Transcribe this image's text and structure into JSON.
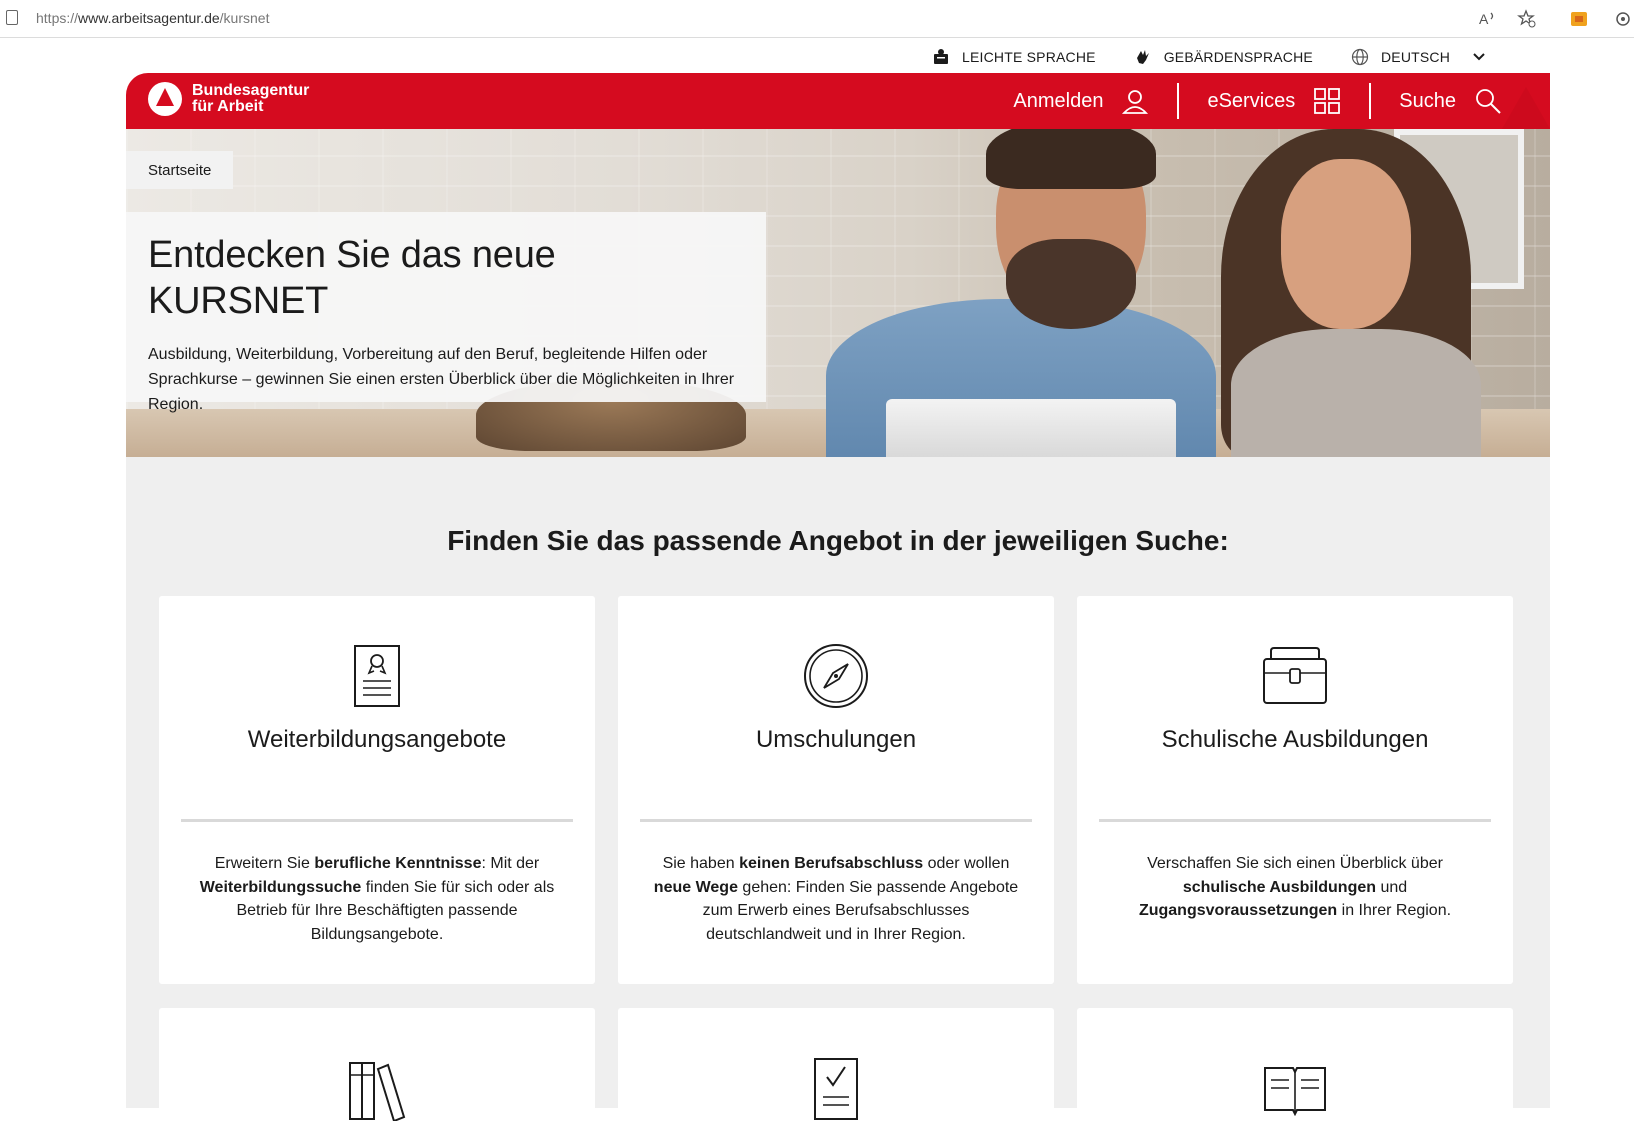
{
  "browser": {
    "url_scheme": "https://",
    "url_host": "www.arbeitsagentur.de",
    "url_path": "/kursnet",
    "icons": [
      "page-icon",
      "read-aloud-icon",
      "favorite-add-icon",
      "extension-icon",
      "settings-icon"
    ]
  },
  "utility_nav": {
    "items": [
      {
        "label": "LEICHTE SPRACHE",
        "icon": "easy-language-icon"
      },
      {
        "label": "GEBÄRDENSPRACHE",
        "icon": "sign-language-icon"
      },
      {
        "label": "DEUTSCH",
        "icon": "globe-icon"
      }
    ]
  },
  "header": {
    "logo_line1": "Bundesagentur",
    "logo_line2": "für Arbeit",
    "nav": [
      {
        "label": "Anmelden",
        "icon": "user-icon"
      },
      {
        "label": "eServices",
        "icon": "grid-icon"
      },
      {
        "label": "Suche",
        "icon": "search-icon"
      }
    ],
    "brand_color": "#d50b1f"
  },
  "hero": {
    "breadcrumb": "Startseite",
    "title": "Entdecken Sie das neue KURSNET",
    "text": "Ausbildung, Weiterbildung, Vorbereitung auf den Beruf, begleitende Hilfen oder Sprachkurse – gewinnen Sie einen ersten Überblick über die Möglichkeiten in Ihrer Region."
  },
  "section": {
    "title": "Finden Sie das passende Angebot in der jeweiligen Suche:"
  },
  "cards": [
    {
      "title": "Weiterbildungsangebote",
      "icon": "certificate-icon",
      "desc": [
        {
          "t": "Erweitern Sie ",
          "b": false
        },
        {
          "t": "berufliche Kenntnisse",
          "b": true
        },
        {
          "t": ": Mit der ",
          "b": false
        },
        {
          "t": "Weiterbildungssuche",
          "b": true
        },
        {
          "t": " finden Sie für sich oder als Betrieb für Ihre Beschäftigten passende Bildungsangebote.",
          "b": false
        }
      ]
    },
    {
      "title": "Umschulungen",
      "icon": "compass-icon",
      "desc": [
        {
          "t": "Sie haben ",
          "b": false
        },
        {
          "t": "keinen Berufsabschluss",
          "b": true
        },
        {
          "t": " oder wollen ",
          "b": false
        },
        {
          "t": "neue Wege",
          "b": true
        },
        {
          "t": " gehen: Finden Sie passende Angebote zum Erwerb eines Berufsabschlusses deutschlandweit und in Ihrer Region.",
          "b": false
        }
      ]
    },
    {
      "title": "Schulische Ausbildungen",
      "icon": "school-bag-icon",
      "desc": [
        {
          "t": "Verschaffen Sie sich einen Überblick über ",
          "b": false
        },
        {
          "t": "schulische Ausbildungen",
          "b": true
        },
        {
          "t": " und ",
          "b": false
        },
        {
          "t": "Zugangsvoraussetzungen",
          "b": true
        },
        {
          "t": " in Ihrer Region.",
          "b": false
        }
      ]
    }
  ],
  "cards_row2": [
    {
      "icon": "books-icon"
    },
    {
      "icon": "checklist-icon"
    },
    {
      "icon": "open-book-icon"
    }
  ]
}
